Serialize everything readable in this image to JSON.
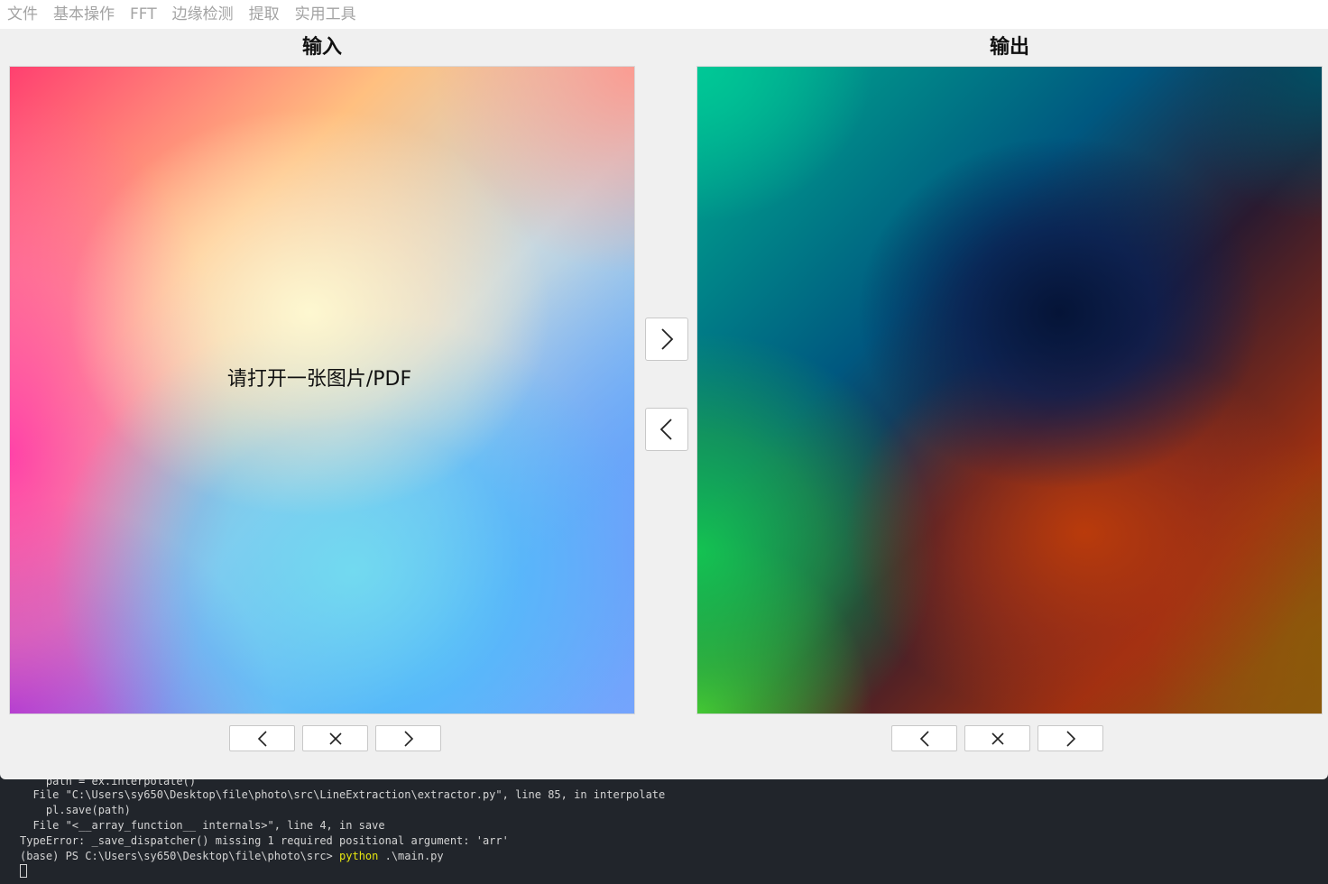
{
  "menubar": {
    "items": [
      "文件",
      "基本操作",
      "FFT",
      "边缘检测",
      "提取",
      "实用工具"
    ]
  },
  "panels": {
    "input": {
      "title": "输入",
      "placeholder": "请打开一张图片/PDF"
    },
    "output": {
      "title": "输出"
    }
  },
  "buttons": {
    "side_next": "next-arrow",
    "side_prev": "prev-arrow",
    "nav_prev": "prev-arrow",
    "nav_close": "close",
    "nav_next": "next-arrow"
  },
  "terminal": {
    "lines": [
      "    path = ex.interpolate()",
      "  File \"C:\\Users\\sy650\\Desktop\\file\\photo\\src\\LineExtraction\\extractor.py\", line 85, in interpolate",
      "    pl.save(path)",
      "  File \"<__array_function__ internals>\", line 4, in save",
      "TypeError: _save_dispatcher() missing 1 required positional argument: 'arr'"
    ],
    "prompt": "(base) PS C:\\Users\\sy650\\Desktop\\file\\photo\\src> ",
    "command": "python",
    "args": " .\\main.py"
  },
  "colors": {
    "menu_text": "#a3a3a3",
    "window_bg": "#f0f0f0",
    "terminal_bg": "#21252b",
    "terminal_cmd": "#e5e510"
  }
}
